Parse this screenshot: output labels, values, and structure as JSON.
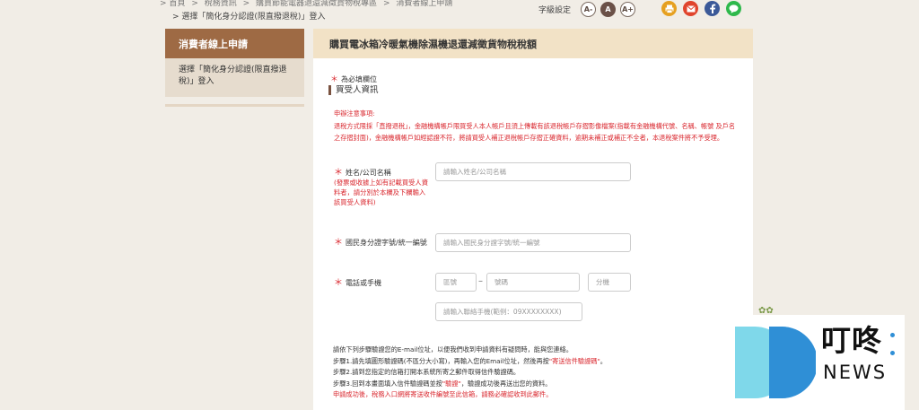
{
  "breadcrumb": {
    "items": [
      "首頁",
      "稅務資訊",
      "購買節能電器退還減徵貨物稅專區",
      "消費者線上申請"
    ],
    "separator": ">",
    "current": "選擇「簡化身分認證(限直撥退稅)」登入"
  },
  "font_size": {
    "label": "字級設定",
    "small": "A-",
    "medium": "A",
    "large": "A+"
  },
  "share_icons": [
    "print-icon",
    "email-icon",
    "facebook-icon",
    "line-icon"
  ],
  "sidebar": {
    "title": "消費者線上申請",
    "items": [
      {
        "label": "選擇「簡化身分認證(限直撥退稅)」登入"
      }
    ]
  },
  "main": {
    "title": "購買電冰箱冷暖氣機除濕機退還減徵貨物稅稅額",
    "required_star": "＊",
    "required_note": "為必填欄位",
    "section_title": "買受人資訊",
    "notice": [
      "申辦注意事項:",
      "退稅方式限採「直撥退稅」，金融機構帳戶限買受人本人帳戶且須上傳載有該退稅帳戶存摺影像檔案(指載有金融機構代號、名稱、帳號 及戶名之存摺封面)，金融機構帳戶如經認證不符，將請買受人補正退稅帳戶存摺正確資料，逾期未補正或補正不全者，本退稅案件將不予受理。"
    ],
    "fields": {
      "name": {
        "label": "姓名/公司名稱",
        "note": "(發票或收據上如有記載買受人資料者，請分別於本欄及下欄輸入該買受人資料)",
        "placeholder": "請輸入姓名/公司名稱"
      },
      "id": {
        "label": "國民身分證字號/統一編號",
        "placeholder": "請輸入國民身分證字號/統一編號"
      },
      "phone": {
        "label": "電話或手機",
        "area_placeholder": "區號",
        "dash": "–",
        "number_placeholder": "號碼",
        "ext_placeholder": "分機",
        "mobile_placeholder": "請輸入聯絡手機(範例：09XXXXXXXX)"
      }
    },
    "steps": {
      "intro": "請依下列步驟驗證您的E-mail位址，以便我們收到申請資料有疑問時，能與您連絡。",
      "step1_pre": "步驟1.請先填圖形驗證碼(不區分大小寫)，再輸入您的Email位址，然後再按",
      "step1_link": "\"寄送信件驗證碼\"",
      "step1_post": "。",
      "step2": "步驟2.請到您指定的信箱打開本系統所寄之郵件取得信件驗證碼。",
      "step3_pre": "步驟3.回到本畫面填入信件驗證碼並按",
      "step3_link": "\"驗證\"",
      "step3_post": "，驗證成功後再送出您的資料。",
      "warning": "申請成功後，稅務入口網將寄送收件編號至此信箱，請務必確認收到此郵件。"
    }
  },
  "watermark": {
    "brand": "叮咚",
    "sub": "NEWS"
  },
  "colors": {
    "sidebar_head": "#9e6a44",
    "panel_head": "#f2e2c6",
    "alert": "#d9262d",
    "logo_cyan": "#7fd8ea",
    "logo_blue": "#2f8fd6"
  }
}
